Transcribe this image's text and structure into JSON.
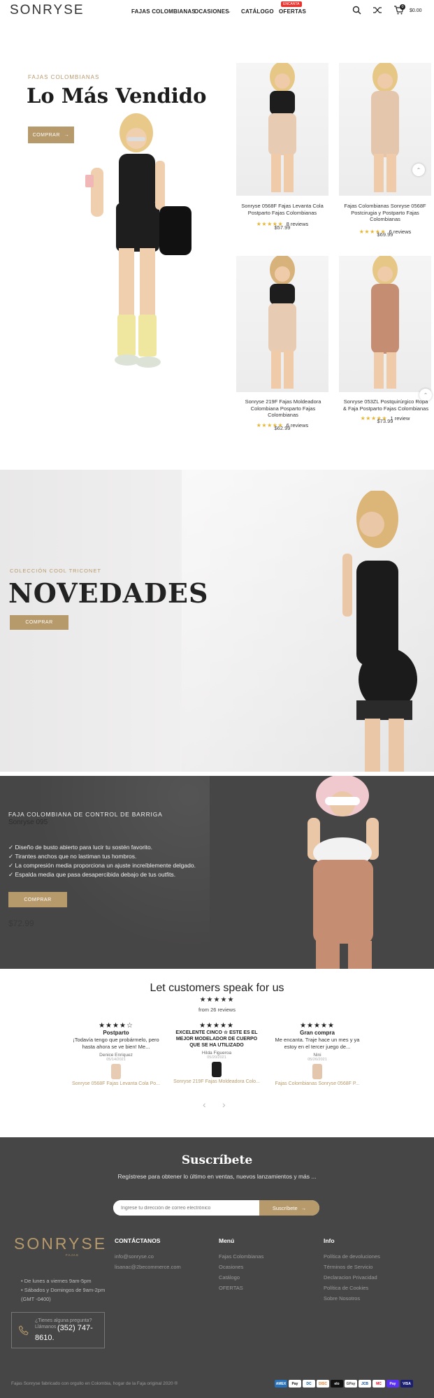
{
  "header": {
    "logo": "SONRYSE",
    "nav": [
      "FAJAS COLOMBIANAS",
      "OCASIONES",
      "CATÁLOGO",
      "OFERTAS"
    ],
    "hot_badge": "ENCANTA",
    "cart_count": "0",
    "cart_total": "$0.00",
    "icons": [
      "search-icon",
      "shuffle-icon",
      "cart-icon"
    ]
  },
  "hero": {
    "kicker": "FAJAS COLOMBIANAS",
    "title": "Lo Más Vendido",
    "button": "COMPRAR"
  },
  "products": [
    {
      "title": "Sonryse 0568F Fajas Levanta Cola Postparto Fajas Colombianas",
      "stars": "★★★★★",
      "reviews": "8 reviews",
      "price": "$57.99",
      "rating": 4.5
    },
    {
      "title": "Fajas Colombianas Sonryse 0568F Postcirugia y Postparto Fajas Colombianas",
      "stars": "★★★★★",
      "reviews": "6 reviews",
      "price": "$69.99",
      "rating": 5
    },
    {
      "title": "Sonryse 219F Fajas Moldeadora Colombiana Posparto Fajas Colombianas",
      "stars": "★★★★★",
      "reviews": "6 reviews",
      "price": "$62.99",
      "rating": 5
    },
    {
      "title": "Sonryse 053ZL Postquirúrgico Ropa & Faja Postparto Fajas Colombianas",
      "stars": "★★★★★",
      "reviews": "1 review",
      "price": "$73.99",
      "rating": 5
    }
  ],
  "novedades": {
    "kicker": "COLECCIÓN COOL TRICONET",
    "title": "NOVEDADES",
    "button": "COMPRAR"
  },
  "feature": {
    "kicker": "FAJA COLOMBIANA DE CONTROL DE BARRIGA",
    "subtitle": "Sonryse 095",
    "bullets": [
      "Diseño de busto abierto para lucir tu sostén favorito.",
      "Tirantes anchos que no lastiman tus hombros.",
      "La compresión media proporciona un ajuste increíblemente delgado.",
      "Espalda media que pasa desapercibida debajo de tus outfits."
    ],
    "button": "COMPRAR",
    "price": "$72.99"
  },
  "reviews": {
    "title": "Let customers speak for us",
    "summary_stars": "★★★★★",
    "summary": "from 26 reviews",
    "items": [
      {
        "stars": "★★★★☆",
        "title": "Postparto",
        "body": "¡Todavía tengo que probármelo, pero hasta ahora se ve bien! Me...",
        "author": "Denice Enriquez",
        "date": "05/14/2021",
        "product": "Sonryse 0568F Fajas Levanta Cola Po..."
      },
      {
        "stars": "★★★★★",
        "title": "EXCELENTE CINCO ☆ ESTE ES EL MEJOR MODELADOR DE CUERPO QUE SE HA UTILIZADO",
        "body": "",
        "author": "Hilda Figueroa",
        "date": "05/20/2021",
        "product": "Sonryse 219F Fajas Moldeadora Colo..."
      },
      {
        "stars": "★★★★★",
        "title": "Gran compra",
        "body": "Me encanta. Traje hace un mes y ya estoy en el tercer juego de...",
        "author": "Nini",
        "date": "05/26/2021",
        "product": "Fajas Colombianas Sonryse 0568F P..."
      }
    ]
  },
  "subscribe": {
    "title": "Suscríbete",
    "text": "Regístrese para obtener lo último en ventas, nuevos lanzamientos y más ...",
    "placeholder": "Ingrese tu dirección de correo electrónico",
    "button": "Suscríbete"
  },
  "footer": {
    "logo": "SONRYSE",
    "logo_sub": "FAJAS",
    "hours": [
      "De lunes a viernes 9am-5pm",
      "Sábados y Domingos de 9am-2pm (GMT -0400)"
    ],
    "phone_q": "¿Tienes alguna pregunta? Llámanos",
    "phone": "(352) 747-8610.",
    "contact_h": "CONTÁCTANOS",
    "contact": [
      "info@sonryse.co",
      "lisanac@2becommerce.com"
    ],
    "menu_h": "Menú",
    "menu": [
      "Fajas Colombianas",
      "Ocasiones",
      "Catálogo",
      "OFERTAS"
    ],
    "info_h": "Info",
    "info": [
      "Política de devoluciones",
      "Términos de Servicio",
      "Declaracion Privacidad",
      "Política de Cookies",
      "Sobre Nosotros"
    ],
    "copyright": "Fajas Sonryse fabricado con orgullo en Colombia, hogar de la Faja original 2020 ®",
    "payments": [
      "AMEX",
      "Pay",
      "DC",
      "DISC",
      "elo",
      "GPay",
      "JCB",
      "MC",
      "Pay",
      "VISA"
    ]
  },
  "colors": {
    "gold": "#b79a6b",
    "dark": "#444444",
    "hot": "#e8332f"
  }
}
